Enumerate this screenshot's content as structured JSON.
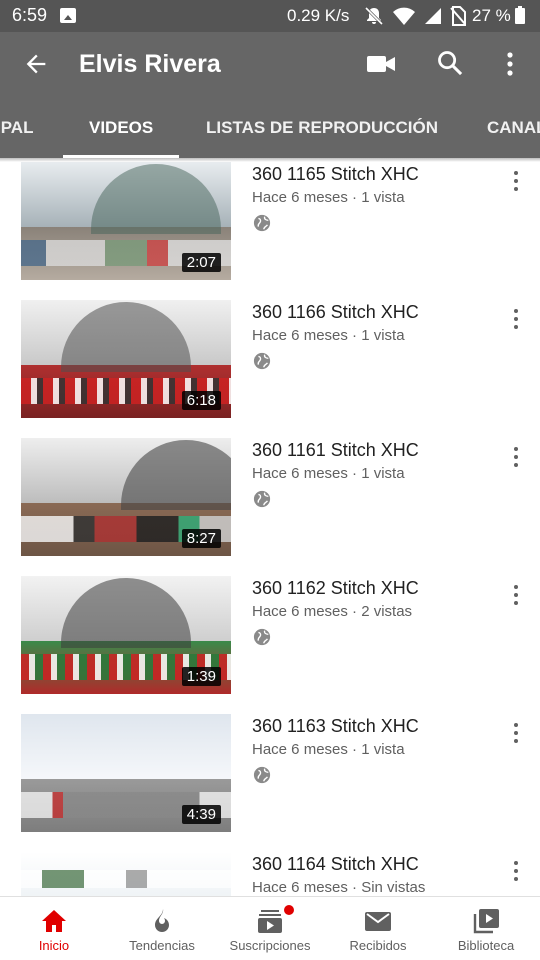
{
  "status_bar": {
    "time": "6:59",
    "network_speed": "0.29 K/s",
    "battery_percent": "27 %",
    "icons": [
      "image-icon",
      "mute-icon",
      "wifi-icon",
      "signal-icon",
      "no-sim-icon",
      "battery-icon"
    ]
  },
  "app_bar": {
    "title": "Elvis Rivera",
    "icons": [
      "back-arrow-icon",
      "video-camera-icon",
      "search-icon",
      "more-vert-icon"
    ]
  },
  "tabs": [
    {
      "label": "IPAL"
    },
    {
      "label": "VIDEOS"
    },
    {
      "label": "LISTAS DE REPRODUCCIÓN"
    },
    {
      "label": "CANAL"
    }
  ],
  "active_tab": "VIDEOS",
  "videos": [
    {
      "title": "360 1165 Stitch XHC",
      "meta": "Hace 6 meses · 1 vista",
      "duration": "2:07"
    },
    {
      "title": "360 1166 Stitch XHC",
      "meta": "Hace 6 meses · 1 vista",
      "duration": "6:18"
    },
    {
      "title": "360 1161 Stitch XHC",
      "meta": "Hace 6 meses · 1 vista",
      "duration": "8:27"
    },
    {
      "title": "360 1162 Stitch XHC",
      "meta": "Hace 6 meses · 2 vistas",
      "duration": "1:39"
    },
    {
      "title": "360 1163 Stitch XHC",
      "meta": "Hace 6 meses · 1 vista",
      "duration": "4:39"
    },
    {
      "title": "360 1164 Stitch XHC",
      "meta": "Hace 6 meses · Sin vistas",
      "duration": ""
    }
  ],
  "bottom_nav": [
    {
      "label": "Inicio",
      "icon": "home-icon"
    },
    {
      "label": "Tendencias",
      "icon": "flame-icon"
    },
    {
      "label": "Suscripciones",
      "icon": "subscriptions-icon"
    },
    {
      "label": "Recibidos",
      "icon": "mail-icon"
    },
    {
      "label": "Biblioteca",
      "icon": "library-icon"
    }
  ],
  "colors": {
    "header": "#666666",
    "status_bar": "#555555",
    "accent": "#e00000"
  }
}
